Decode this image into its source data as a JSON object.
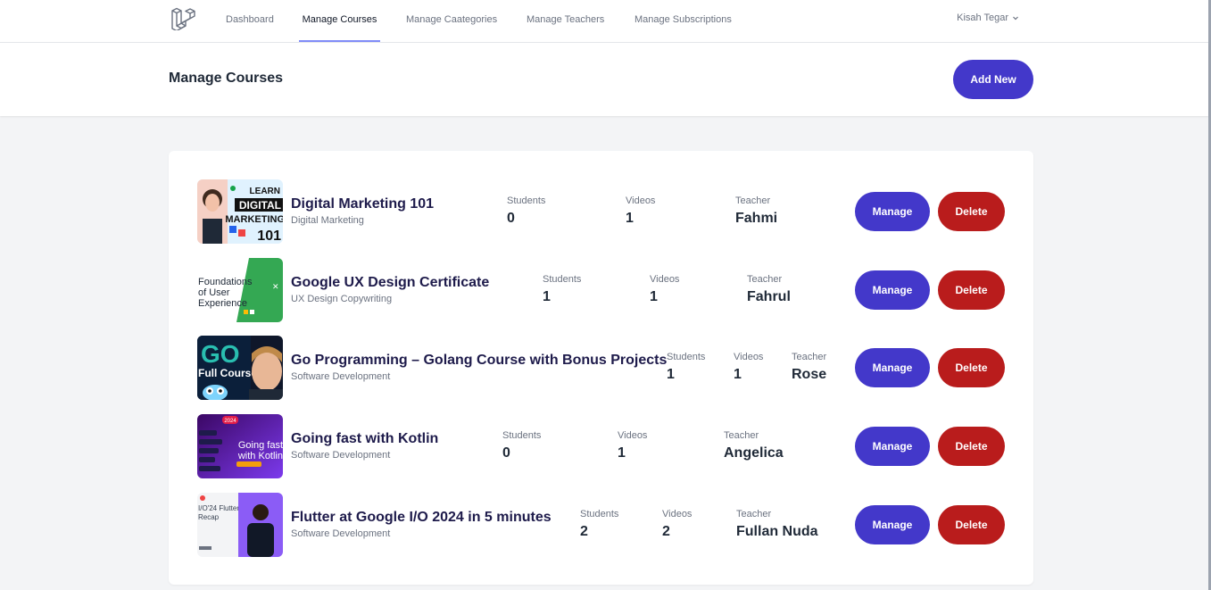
{
  "nav": {
    "links": [
      "Dashboard",
      "Manage Courses",
      "Manage Caategories",
      "Manage Teachers",
      "Manage Subscriptions"
    ],
    "active_index": 1,
    "user_name": "Kisah Tegar"
  },
  "header": {
    "title": "Manage Courses",
    "add_label": "Add New"
  },
  "labels": {
    "students": "Students",
    "videos": "Videos",
    "teacher": "Teacher",
    "manage": "Manage",
    "delete": "Delete"
  },
  "courses": [
    {
      "title": "Digital Marketing 101",
      "category": "Digital Marketing",
      "students": "0",
      "videos": "1",
      "teacher": "Fahmi",
      "thumb_text": [
        "LEARN",
        "DIGITAL",
        "MARKETING",
        "101"
      ]
    },
    {
      "title": "Google UX Design Certificate",
      "category": "UX Design Copywriting",
      "students": "1",
      "videos": "1",
      "teacher": "Fahrul",
      "thumb_text": [
        "Foundations",
        "of User",
        "Experience"
      ]
    },
    {
      "title": "Go Programming – Golang Course with Bonus Projects",
      "category": "Software Development",
      "students": "1",
      "videos": "1",
      "teacher": "Rose",
      "thumb_text": [
        "GO",
        "Full Course"
      ]
    },
    {
      "title": "Going fast with Kotlin",
      "category": "Software Development",
      "students": "0",
      "videos": "1",
      "teacher": "Angelica",
      "thumb_text": [
        "2024",
        "Going fast",
        "with Kotlin"
      ]
    },
    {
      "title": "Flutter at Google I/O 2024 in 5 minutes",
      "category": "Software Development",
      "students": "2",
      "videos": "2",
      "teacher": "Fullan Nuda",
      "thumb_text": [
        "I/O'24 Flutter",
        "Recap"
      ]
    }
  ],
  "colors": {
    "primary": "#4338ca",
    "danger": "#b91c1c",
    "page_bg": "#f3f4f6"
  }
}
